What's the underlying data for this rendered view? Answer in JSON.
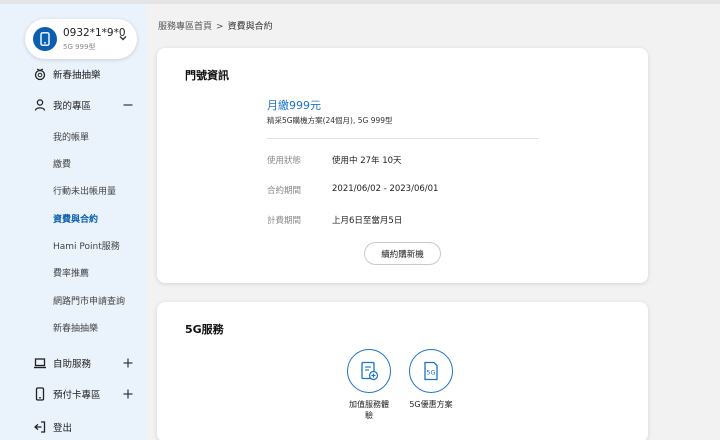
{
  "account": {
    "number": "0932*1*9*0",
    "plan": "5G 999型"
  },
  "sidebar": {
    "lottery": "新春抽抽樂",
    "my_area": "我的專區",
    "sub_items": [
      "我的帳單",
      "繳費",
      "行動未出帳用量",
      "資費與合約",
      "Hami Point服務",
      "費率推薦",
      "網路門市申請查詢",
      "新春抽抽樂"
    ],
    "self_service": "自助服務",
    "prepaid": "預付卡專區",
    "logout": "登出"
  },
  "breadcrumb": {
    "home": "服務專區首頁",
    "separator": ">",
    "current": "資費與合約"
  },
  "number_info": {
    "title": "門號資訊",
    "plan_name": "月繳999元",
    "plan_desc": "精采5G購機方案(24個月), 5G 999型",
    "rows": [
      {
        "label": "使用狀態",
        "value": "使用中 27年 10天"
      },
      {
        "label": "合約期間",
        "value": "2021/06/02 - 2023/06/01"
      },
      {
        "label": "計費期間",
        "value": "上月6日至當月5日"
      }
    ],
    "renew_button": "續約購新機"
  },
  "service_5g": {
    "title": "5G服務",
    "items": [
      {
        "label": "加值服務體驗",
        "icon": "add-service-icon"
      },
      {
        "label": "5G優惠方案",
        "icon": "5g-icon"
      }
    ]
  },
  "colors": {
    "accent": "#1a73c8",
    "sidebar_bg": "#eaf2fb",
    "active_text": "#0c5fb0"
  }
}
